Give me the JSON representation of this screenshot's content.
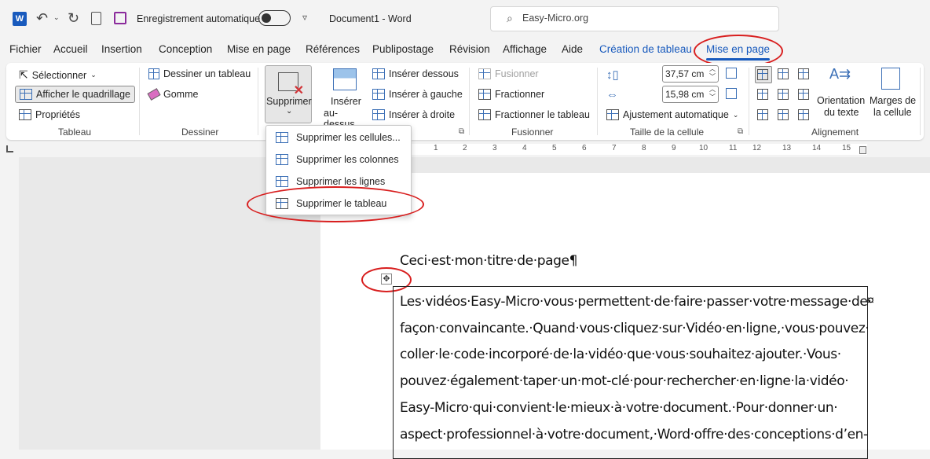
{
  "titlebar": {
    "autosave_label": "Enregistrement automatique",
    "doc_title": "Document1 - Word",
    "search_placeholder": "Easy-Micro.org"
  },
  "tabs": [
    "Fichier",
    "Accueil",
    "Insertion",
    "Conception",
    "Mise en page",
    "Références",
    "Publipostage",
    "Révision",
    "Affichage",
    "Aide",
    "Création de tableau",
    "Mise en page"
  ],
  "ribbon": {
    "tableau": {
      "select": "Sélectionner",
      "grid": "Afficher le quadrillage",
      "props": "Propriétés",
      "label": "Tableau"
    },
    "dessiner": {
      "draw": "Dessiner un tableau",
      "eraser": "Gomme",
      "label": "Dessiner"
    },
    "supprimer": "Supprimer",
    "inserer": {
      "above1": "Insérer",
      "above2": "au-dessus",
      "below": "Insérer dessous",
      "left": "Insérer à gauche",
      "right": "Insérer à droite"
    },
    "fusionner": {
      "merge": "Fusionner",
      "split": "Fractionner",
      "split_table": "Fractionner le tableau",
      "label": "Fusionner"
    },
    "taille": {
      "height": "37,57 cm",
      "width": "15,98 cm",
      "autofit": "Ajustement automatique",
      "label": "Taille de la cellule"
    },
    "alignement": {
      "orient1": "Orientation",
      "orient2": "du texte",
      "margins1": "Marges de",
      "margins2": "la cellule",
      "label": "Alignement"
    }
  },
  "menu": [
    "Supprimer les cellules...",
    "Supprimer les colonnes",
    "Supprimer les lignes",
    "Supprimer le tableau"
  ],
  "ruler_numbers": [
    "1",
    "2",
    "3",
    "4",
    "5",
    "6",
    "7",
    "8",
    "9",
    "10",
    "11",
    "12",
    "13",
    "14",
    "15"
  ],
  "document": {
    "title": "Ceci·est·mon·titre·de·page¶",
    "lines": [
      "Les·vidéos·Easy-Micro·vous·permettent·de·faire·passer·votre·message·de·",
      "façon·convaincante.·Quand·vous·cliquez·sur·Vidéo·en·ligne,·vous·pouvez·",
      "coller·le·code·incorporé·de·la·vidéo·que·vous·souhaitez·ajouter.·Vous·",
      "pouvez·également·taper·un·mot-clé·pour·rechercher·en·ligne·la·vidéo·",
      "Easy-Micro·qui·convient·le·mieux·à·votre·document.·Pour·donner·un·",
      "aspect·professionnel·à·votre·document,·Word·offre·des·conceptions·d’en-"
    ]
  },
  "colors": {
    "accent": "#185abd",
    "annotation": "#d81e1e"
  }
}
